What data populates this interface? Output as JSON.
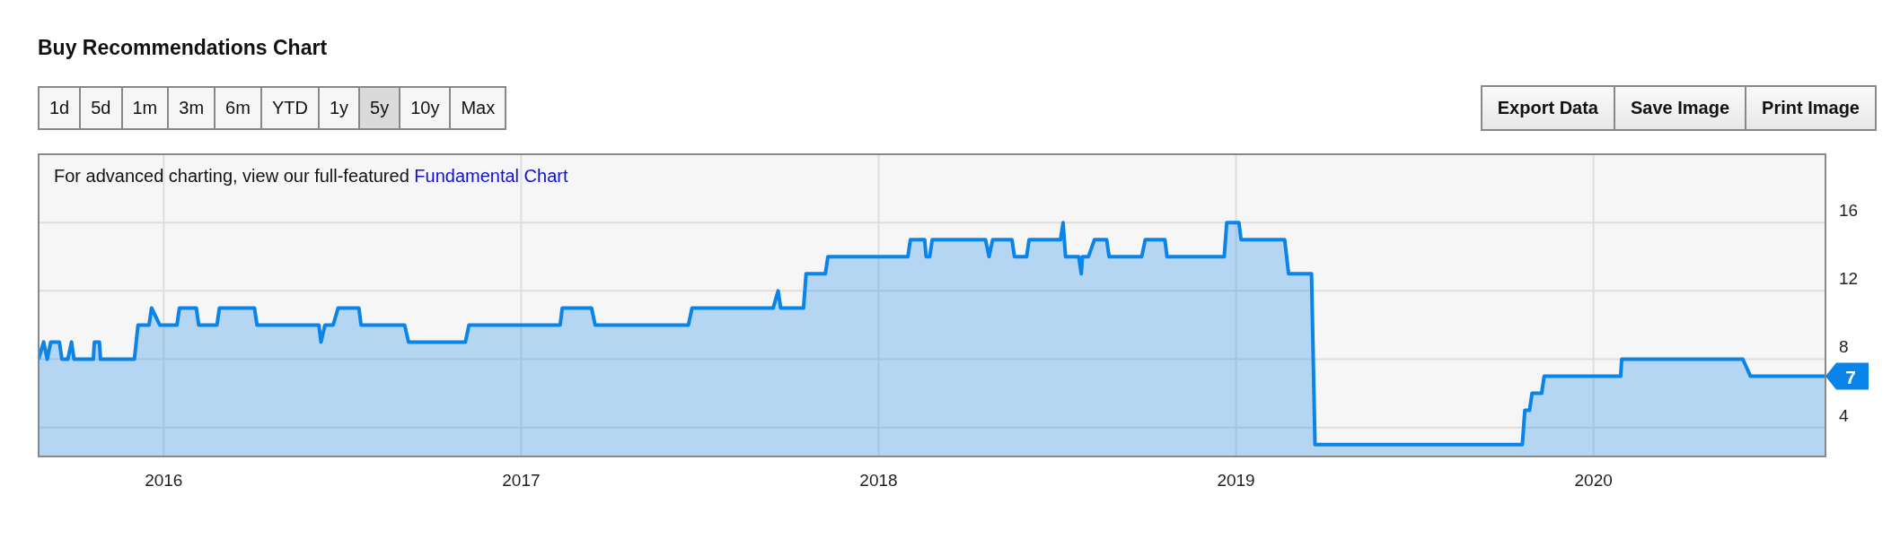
{
  "title": "Buy Recommendations Chart",
  "ranges": [
    {
      "label": "1d",
      "selected": false
    },
    {
      "label": "5d",
      "selected": false
    },
    {
      "label": "1m",
      "selected": false
    },
    {
      "label": "3m",
      "selected": false
    },
    {
      "label": "6m",
      "selected": false
    },
    {
      "label": "YTD",
      "selected": false
    },
    {
      "label": "1y",
      "selected": false
    },
    {
      "label": "5y",
      "selected": true
    },
    {
      "label": "10y",
      "selected": false
    },
    {
      "label": "Max",
      "selected": false
    }
  ],
  "actions": [
    "Export Data",
    "Save Image",
    "Print Image"
  ],
  "chart": {
    "note": "For advanced charting, view our full-featured",
    "note_link": "Fundamental Chart",
    "chart_data": {
      "type": "area",
      "x": [
        2015.65,
        2015.664,
        2015.674,
        2015.684,
        2015.708,
        2015.715,
        2015.732,
        2015.742,
        2015.749,
        2015.803,
        2015.806,
        2015.82,
        2015.823,
        2015.918,
        2015.928,
        2015.959,
        2015.966,
        2015.989,
        2016.037,
        2016.044,
        2016.091,
        2016.098,
        2016.149,
        2016.156,
        2016.254,
        2016.261,
        2016.434,
        2016.44,
        2016.451,
        2016.474,
        2016.488,
        2016.546,
        2016.552,
        2016.674,
        2016.685,
        2016.844,
        2016.854,
        2017.109,
        2017.115,
        2017.197,
        2017.207,
        2017.468,
        2017.478,
        2017.705,
        2017.719,
        2017.726,
        2017.79,
        2017.797,
        2017.851,
        2017.858,
        2018.082,
        2018.089,
        2018.129,
        2018.133,
        2018.143,
        2018.15,
        2018.299,
        2018.309,
        2018.319,
        2018.373,
        2018.38,
        2018.414,
        2018.421,
        2018.509,
        2018.516,
        2018.523,
        2018.56,
        2018.567,
        2018.57,
        2018.587,
        2018.604,
        2018.638,
        2018.645,
        2018.736,
        2018.746,
        2018.801,
        2018.807,
        2018.967,
        2018.974,
        2019.008,
        2019.014,
        2019.136,
        2019.147,
        2019.211,
        2019.221,
        2019.801,
        2019.808,
        2019.821,
        2019.828,
        2019.855,
        2019.862,
        2020.076,
        2020.079,
        2020.418,
        2020.439,
        2020.649
      ],
      "series": [
        {
          "color": "#0a84e8",
          "values": [
            8,
            9,
            8,
            9,
            9,
            8,
            8,
            9,
            8,
            8,
            9,
            9,
            8,
            8,
            10,
            10,
            11,
            10,
            10,
            11,
            11,
            10,
            10,
            11,
            11,
            10,
            10,
            9,
            10,
            10,
            11,
            11,
            10,
            10,
            9,
            9,
            10,
            10,
            11,
            11,
            10,
            10,
            11,
            11,
            12,
            11,
            11,
            13,
            13,
            14,
            14,
            15,
            15,
            14,
            14,
            15,
            15,
            14,
            15,
            15,
            14,
            14,
            15,
            15,
            16,
            14,
            14,
            13,
            14,
            14,
            15,
            15,
            14,
            14,
            15,
            15,
            14,
            14,
            16,
            16,
            15,
            15,
            13,
            13,
            3,
            3,
            5,
            5,
            6,
            6,
            7,
            7,
            8,
            8,
            7,
            7
          ]
        }
      ],
      "xlim": [
        2015.65,
        2020.649
      ],
      "ylim": [
        2.3,
        20
      ],
      "xticks": [
        {
          "value": 2016,
          "label": "2016"
        },
        {
          "value": 2017,
          "label": "2017"
        },
        {
          "value": 2018,
          "label": "2018"
        },
        {
          "value": 2019,
          "label": "2019"
        },
        {
          "value": 2020,
          "label": "2020"
        }
      ],
      "yticks": [
        4,
        8,
        12,
        16
      ],
      "grid": true
    },
    "last_value_badge": "7"
  }
}
